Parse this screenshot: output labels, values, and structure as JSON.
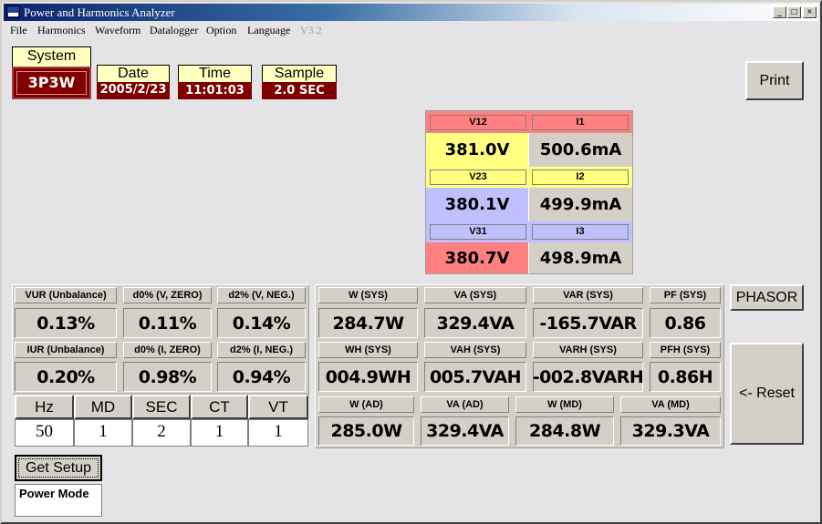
{
  "window": {
    "title": "Power and Harmonics Analyzer",
    "minimize": "_",
    "maximize": "□",
    "close": "×"
  },
  "menu": [
    "File",
    "Harmonics",
    "Waveform",
    "Datalogger",
    "Option",
    "Language",
    "V3.2"
  ],
  "system": {
    "label": "System",
    "value": "3P3W"
  },
  "date": {
    "label": "Date",
    "value": "2005/2/23"
  },
  "time": {
    "label": "Time",
    "value": "11:01:03"
  },
  "sample": {
    "label": "Sample",
    "value": "2.0 SEC"
  },
  "print_label": "Print",
  "phases": [
    {
      "vlabel": "V12",
      "ilabel": "I1",
      "v": "381.0V",
      "i": "500.6mA"
    },
    {
      "vlabel": "V23",
      "ilabel": "I2",
      "v": "380.1V",
      "i": "499.9mA"
    },
    {
      "vlabel": "V31",
      "ilabel": "I3",
      "v": "380.7V",
      "i": "498.9mA"
    }
  ],
  "colors": {
    "red": "#ff8080",
    "yellow": "#ffff80",
    "blue": "#c0c0ff",
    "dark_red": "#800000"
  },
  "unbalance": [
    {
      "label": "VUR (Unbalance)",
      "value": "0.13%"
    },
    {
      "label": "d0% (V, ZERO)",
      "value": "0.11%"
    },
    {
      "label": "d2% (V, NEG.)",
      "value": "0.14%"
    },
    {
      "label": "IUR (Unbalance)",
      "value": "0.20%"
    },
    {
      "label": "d0% (I, ZERO)",
      "value": "0.98%"
    },
    {
      "label": "d2% (I, NEG.)",
      "value": "0.94%"
    }
  ],
  "power": [
    {
      "label": "W (SYS)",
      "value": "284.7W"
    },
    {
      "label": "VA (SYS)",
      "value": "329.4VA"
    },
    {
      "label": "VAR (SYS)",
      "value": "-165.7VAR"
    },
    {
      "label": "PF (SYS)",
      "value": "0.86"
    },
    {
      "label": "WH (SYS)",
      "value": "004.9WH"
    },
    {
      "label": "VAH (SYS)",
      "value": "005.7VAH"
    },
    {
      "label": "VARH (SYS)",
      "value": "-002.8VARH"
    },
    {
      "label": "PFH (SYS)",
      "value": "0.86H"
    },
    {
      "label": "W (AD)",
      "value": "285.0W"
    },
    {
      "label": "VA (AD)",
      "value": "329.4VA"
    },
    {
      "label": "W (MD)",
      "value": "284.8W"
    },
    {
      "label": "VA (MD)",
      "value": "329.3VA"
    }
  ],
  "setup": [
    {
      "label": "Hz",
      "value": "50"
    },
    {
      "label": "MD",
      "value": "1"
    },
    {
      "label": "SEC",
      "value": "2"
    },
    {
      "label": "CT",
      "value": "1"
    },
    {
      "label": "VT",
      "value": "1"
    }
  ],
  "phasor_label": "PHASOR",
  "reset_label": "<- Reset",
  "get_setup_label": "Get Setup",
  "mode_text": "Power Mode"
}
